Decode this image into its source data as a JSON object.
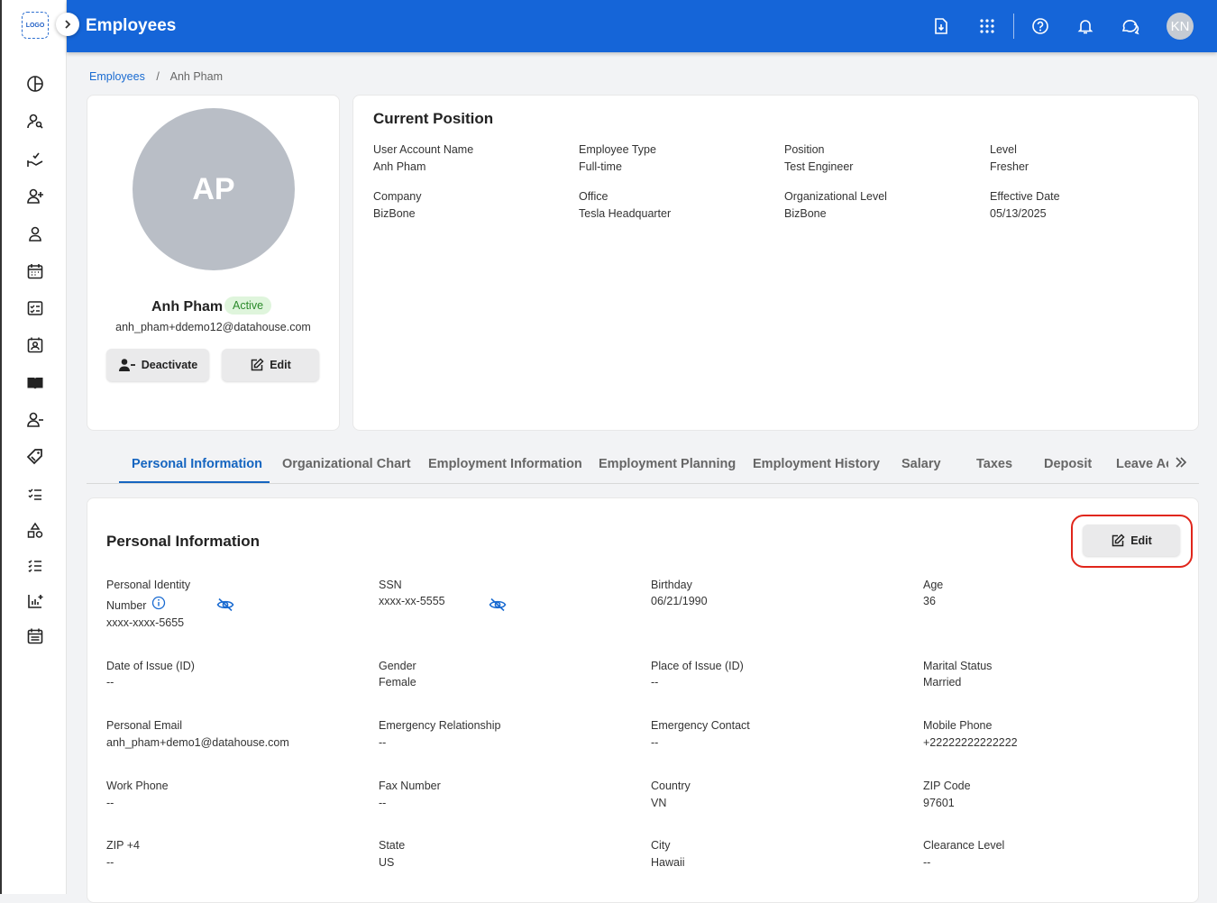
{
  "app": {
    "logo_text": "LOGO",
    "title": "Employees",
    "user_initials": "KN"
  },
  "breadcrumb": {
    "root": "Employees",
    "separator": "/",
    "current": "Anh Pham"
  },
  "profile": {
    "initials": "AP",
    "name": "Anh Pham",
    "status": "Active",
    "email": "anh_pham+ddemo12@datahouse.com",
    "deactivate_label": "Deactivate",
    "edit_label": "Edit"
  },
  "current_position": {
    "title": "Current Position",
    "fields": [
      {
        "label": "User Account Name",
        "value": "Anh Pham"
      },
      {
        "label": "Employee Type",
        "value": "Full-time"
      },
      {
        "label": "Position",
        "value": "Test Engineer"
      },
      {
        "label": "Level",
        "value": "Fresher"
      },
      {
        "label": "Company",
        "value": "BizBone"
      },
      {
        "label": "Office",
        "value": "Tesla Headquarter"
      },
      {
        "label": "Organizational Level",
        "value": "BizBone"
      },
      {
        "label": "Effective Date",
        "value": "05/13/2025"
      }
    ]
  },
  "tabs": [
    "Personal Information",
    "Organizational Chart",
    "Employment Information",
    "Employment Planning",
    "Employment History",
    "Salary",
    "Taxes",
    "Deposit",
    "Leave Ac"
  ],
  "personal_info": {
    "title": "Personal Information",
    "edit_label": "Edit",
    "pin_label_1": "Personal Identity",
    "pin_label_2": "Number",
    "fields": [
      {
        "label": "Personal Identity Number",
        "value": "xxxx-xxxx-5655"
      },
      {
        "label": "SSN",
        "value": "xxxx-xx-5555"
      },
      {
        "label": "Birthday",
        "value": "06/21/1990"
      },
      {
        "label": "Age",
        "value": "36"
      },
      {
        "label": "Date of Issue (ID)",
        "value": "--"
      },
      {
        "label": "Gender",
        "value": "Female"
      },
      {
        "label": "Place of Issue (ID)",
        "value": "--"
      },
      {
        "label": "Marital Status",
        "value": "Married"
      },
      {
        "label": "Personal Email",
        "value": "anh_pham+demo1@datahouse.com"
      },
      {
        "label": "Emergency Relationship",
        "value": "--"
      },
      {
        "label": "Emergency Contact",
        "value": "--"
      },
      {
        "label": "Mobile Phone",
        "value": "+22222222222222"
      },
      {
        "label": "Work Phone",
        "value": "--"
      },
      {
        "label": "Fax Number",
        "value": "--"
      },
      {
        "label": "Country",
        "value": "VN"
      },
      {
        "label": "ZIP Code",
        "value": "97601"
      },
      {
        "label": "ZIP +4",
        "value": "--"
      },
      {
        "label": "State",
        "value": "US"
      },
      {
        "label": "City",
        "value": "Hawaii"
      },
      {
        "label": "Clearance Level",
        "value": "--"
      }
    ]
  }
}
